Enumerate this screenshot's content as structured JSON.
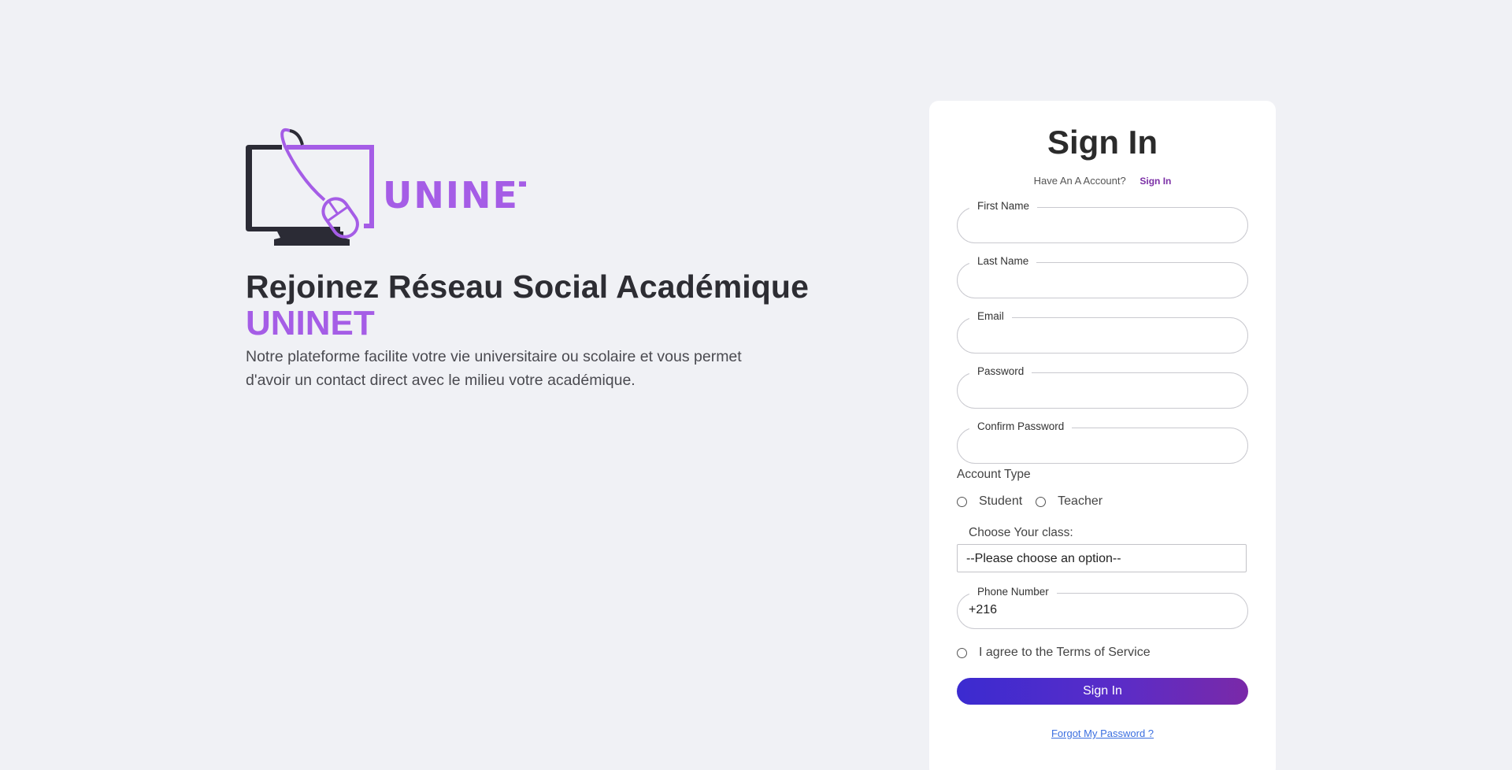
{
  "brand": {
    "logo_text": "UNINET",
    "accent_color": "#a55de6",
    "dark_color": "#2b2b35"
  },
  "hero": {
    "title": "Rejoinez Réseau Social Académique",
    "brand_name": "UNINET",
    "description": "Notre plateforme facilite votre vie universitaire ou scolaire et vous permet d'avoir un contact direct avec le milieu votre académique."
  },
  "form": {
    "title": "Sign In",
    "have_account_text": "Have An A Account?",
    "have_account_link": "Sign In",
    "fields": {
      "first_name": {
        "label": "First Name",
        "value": ""
      },
      "last_name": {
        "label": "Last Name",
        "value": ""
      },
      "email": {
        "label": "Email",
        "value": ""
      },
      "password": {
        "label": "Password",
        "value": ""
      },
      "confirm_password": {
        "label": "Confirm Password",
        "value": ""
      },
      "phone": {
        "label": "Phone Number",
        "value": "+216"
      }
    },
    "account_type": {
      "label": "Account Type",
      "options": [
        "Student",
        "Teacher"
      ]
    },
    "class_select": {
      "label": "Choose Your class:",
      "selected": "--Please choose an option--"
    },
    "terms_label": "I agree to the Terms of Service",
    "submit_label": "Sign In",
    "forgot_label": "Forgot My Password ?",
    "button_gradient": [
      "#3b2bd0",
      "#7a29a8"
    ]
  }
}
